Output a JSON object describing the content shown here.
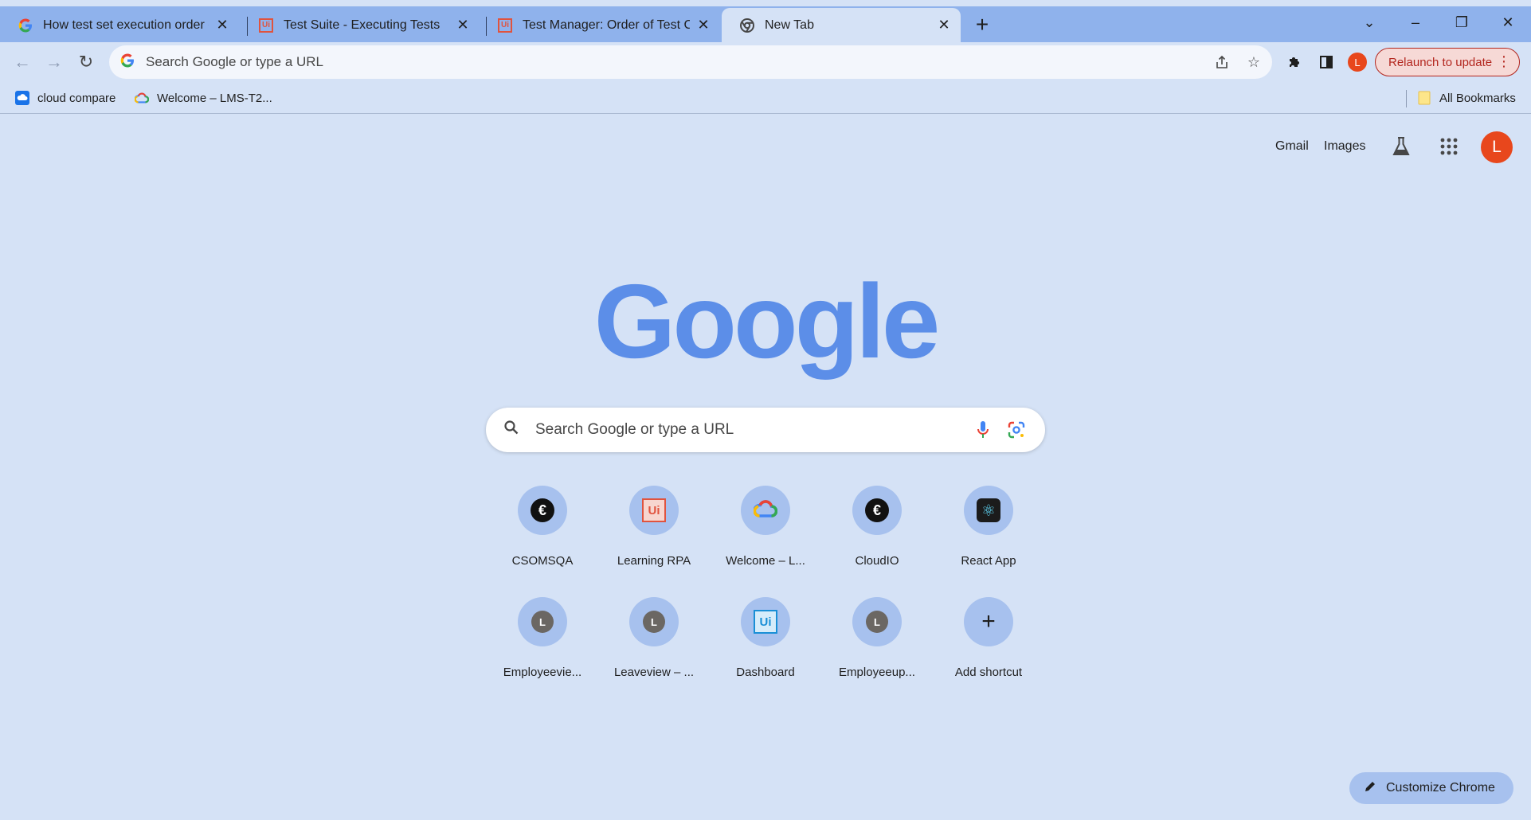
{
  "tabs": [
    {
      "title": "How test set execution order of",
      "favicon": "google-g-icon"
    },
    {
      "title": "Test Suite - Executing Tests",
      "favicon": "uipath-icon"
    },
    {
      "title": "Test Manager: Order of Test Cas",
      "favicon": "uipath-icon"
    },
    {
      "title": "New Tab",
      "favicon": "chrome-icon"
    }
  ],
  "omnibox": {
    "placeholder": "Search Google or type a URL"
  },
  "toolbar": {
    "profile_initial": "L",
    "relaunch_label": "Relaunch to update"
  },
  "bookmarks": {
    "items": [
      {
        "label": "cloud compare",
        "icon": "cloud-icon"
      },
      {
        "label": "Welcome – LMS-T2...",
        "icon": "google-cloud-icon"
      }
    ],
    "all_bookmarks_label": "All Bookmarks"
  },
  "ntp": {
    "gmail_label": "Gmail",
    "images_label": "Images",
    "avatar_initial": "L",
    "logo_text": "Google",
    "search_placeholder": "Search Google or type a URL",
    "customize_label": "Customize Chrome"
  },
  "shortcuts": [
    {
      "label": "CSOMSQA",
      "icon": "globe-dark-icon"
    },
    {
      "label": "Learning RPA",
      "icon": "uipath-icon"
    },
    {
      "label": "Welcome – L...",
      "icon": "google-cloud-icon"
    },
    {
      "label": "CloudIO",
      "icon": "globe-dark-icon"
    },
    {
      "label": "React App",
      "icon": "react-icon"
    },
    {
      "label": "Employeevie...",
      "icon": "letter-avatar-icon",
      "initial": "L"
    },
    {
      "label": "Leaveview – ...",
      "icon": "letter-avatar-icon",
      "initial": "L"
    },
    {
      "label": "Dashboard",
      "icon": "uipath-blue-icon"
    },
    {
      "label": "Employeeup...",
      "icon": "letter-avatar-icon",
      "initial": "L"
    },
    {
      "label": "Add shortcut",
      "icon": "plus-icon"
    }
  ],
  "colors": {
    "accent": "#5c8ee8",
    "tabstrip": "#8fb2ec",
    "page_bg": "#d5e2f6",
    "profile": "#e8471c"
  }
}
